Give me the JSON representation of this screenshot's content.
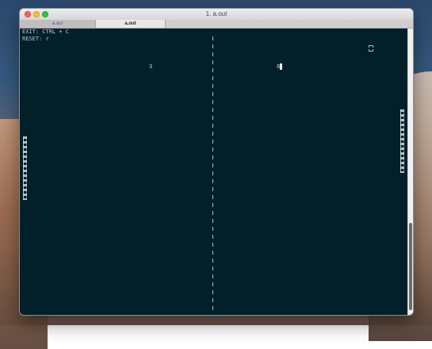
{
  "window": {
    "title": "1. a.out"
  },
  "tabs": [
    {
      "label": "a.out",
      "active": false
    },
    {
      "label": "a.out",
      "active": true
    }
  ],
  "terminal": {
    "lines": [
      "EXIT: CTRL + C",
      "RESET: r"
    ],
    "scores": {
      "left": "3",
      "right": "6"
    }
  },
  "colors": {
    "terminal_bg": "#02202a",
    "terminal_text": "#b9c6cc",
    "tab_active_text": "#7d3ba6"
  },
  "icons": {
    "window_controls": [
      "close-icon",
      "minimize-icon",
      "zoom-icon"
    ]
  }
}
